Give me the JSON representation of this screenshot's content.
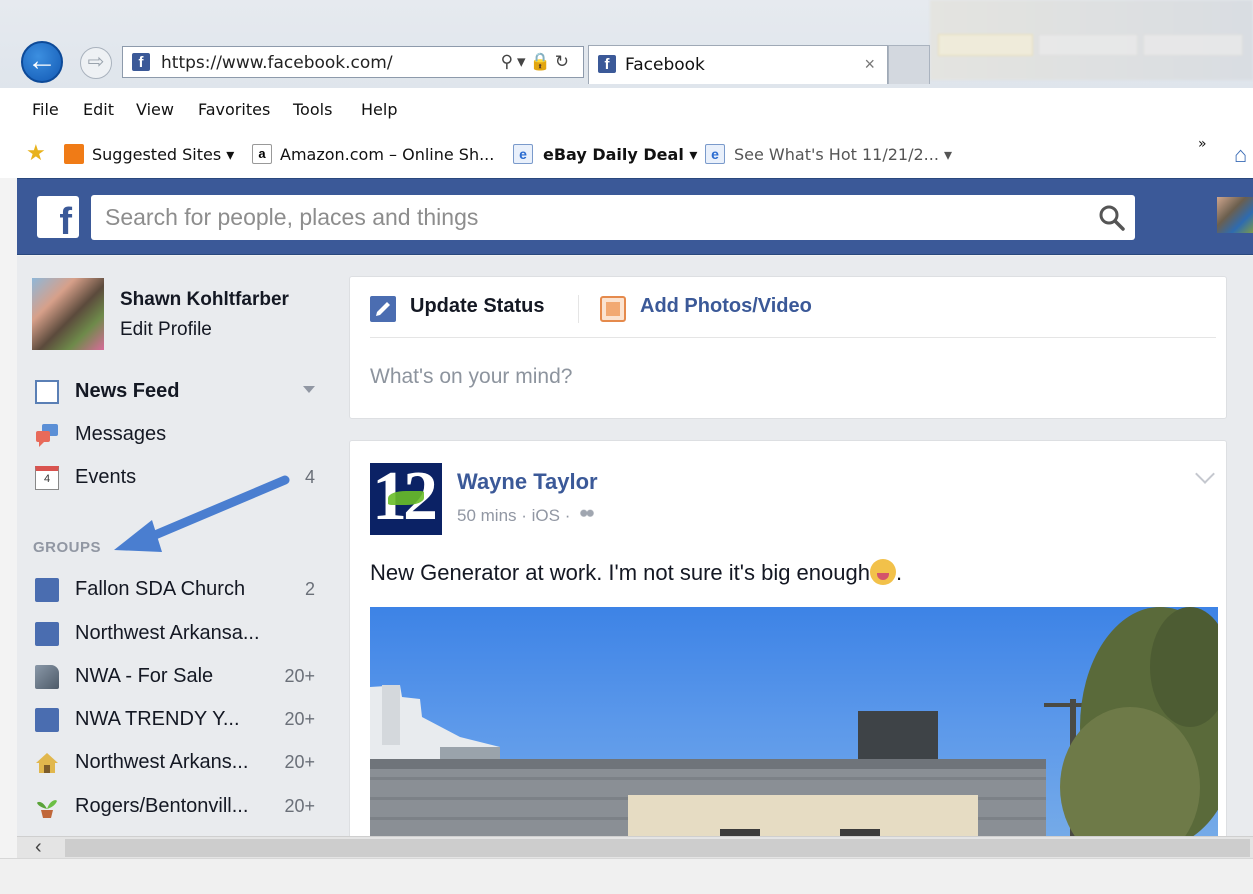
{
  "browser": {
    "url": "https://www.facebook.com/",
    "tab_title": "Facebook",
    "tab_close": "×",
    "menu": [
      "File",
      "Edit",
      "View",
      "Favorites",
      "Tools",
      "Help"
    ],
    "favorites": [
      {
        "label": "Suggested Sites ▾"
      },
      {
        "label": "Amazon.com – Online Sh..."
      },
      {
        "label": "eBay Daily Deal ▾"
      },
      {
        "label": "See What's Hot 11/21/2... ▾"
      }
    ],
    "overflow": "»"
  },
  "header": {
    "logo": "f",
    "search_placeholder": "Search for people, places and things"
  },
  "profile": {
    "name": "Shawn Kohltfarber",
    "edit": "Edit Profile"
  },
  "nav": [
    {
      "label": "News Feed",
      "count": ""
    },
    {
      "label": "Messages",
      "count": ""
    },
    {
      "label": "Events",
      "count": "4"
    }
  ],
  "groups_heading": "GROUPS",
  "groups": [
    {
      "label": "Fallon SDA Church",
      "count": "2"
    },
    {
      "label": "Northwest Arkansa...",
      "count": ""
    },
    {
      "label": "NWA - For Sale",
      "count": "20+"
    },
    {
      "label": "NWA TRENDY Y...",
      "count": "20+"
    },
    {
      "label": "Northwest Arkans...",
      "count": "20+"
    },
    {
      "label": "Rogers/Bentonvill...",
      "count": "20+"
    }
  ],
  "composer": {
    "update_status": "Update Status",
    "add_photos": "Add Photos/Video",
    "placeholder": "What's on your mind?"
  },
  "post": {
    "author": "Wayne Taylor",
    "meta": "50 mins · iOS ·",
    "text": "New Generator at work. I'm not sure it's big enough",
    "text_end": ".",
    "avatar_text": "12"
  },
  "colors": {
    "facebook_blue": "#3b5998",
    "link_blue": "#3b5998",
    "annotation_arrow": "#4a7ed0"
  }
}
